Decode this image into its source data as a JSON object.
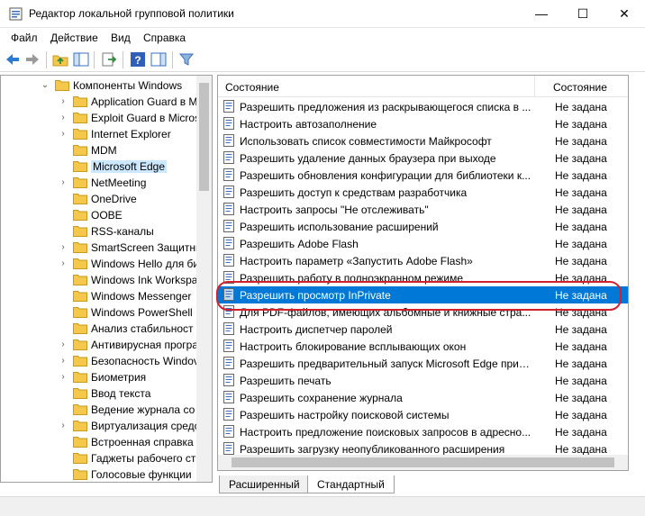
{
  "window": {
    "title": "Редактор локальной групповой политики",
    "minimize_glyph": "—",
    "maximize_glyph": "☐",
    "close_glyph": "✕"
  },
  "menu": [
    "Файл",
    "Действие",
    "Вид",
    "Справка"
  ],
  "toolbar_icons": [
    "back-icon",
    "forward-icon",
    "up-folder-icon",
    "show-hide-tree-icon",
    "export-list-icon",
    "help-icon",
    "show-hide-action-pane-icon",
    "filter-icon"
  ],
  "tree": {
    "items": [
      {
        "label": "Компоненты Windows",
        "expanded": true,
        "indent": 0
      },
      {
        "label": "Application Guard в M",
        "expanded": false,
        "indent": 1
      },
      {
        "label": "Exploit Guard в Micros",
        "expanded": false,
        "indent": 1
      },
      {
        "label": "Internet Explorer",
        "expanded": false,
        "indent": 1
      },
      {
        "label": "MDM",
        "expanded": null,
        "indent": 1
      },
      {
        "label": "Microsoft Edge",
        "expanded": null,
        "indent": 1,
        "selected": true
      },
      {
        "label": "NetMeeting",
        "expanded": false,
        "indent": 1
      },
      {
        "label": "OneDrive",
        "expanded": null,
        "indent": 1
      },
      {
        "label": "OOBE",
        "expanded": null,
        "indent": 1
      },
      {
        "label": "RSS-каналы",
        "expanded": null,
        "indent": 1
      },
      {
        "label": "SmartScreen Защитни",
        "expanded": false,
        "indent": 1
      },
      {
        "label": "Windows Hello для би",
        "expanded": false,
        "indent": 1
      },
      {
        "label": "Windows Ink Workspa",
        "expanded": null,
        "indent": 1
      },
      {
        "label": "Windows Messenger",
        "expanded": null,
        "indent": 1
      },
      {
        "label": "Windows PowerShell",
        "expanded": null,
        "indent": 1
      },
      {
        "label": "Анализ стабильност",
        "expanded": null,
        "indent": 1
      },
      {
        "label": "Антивирусная програ",
        "expanded": false,
        "indent": 1
      },
      {
        "label": "Безопасность Windov",
        "expanded": false,
        "indent": 1
      },
      {
        "label": "Биометрия",
        "expanded": false,
        "indent": 1
      },
      {
        "label": "Ввод текста",
        "expanded": null,
        "indent": 1
      },
      {
        "label": "Ведение журнала со",
        "expanded": null,
        "indent": 1
      },
      {
        "label": "Виртуализация средс",
        "expanded": false,
        "indent": 1
      },
      {
        "label": "Встроенная справка",
        "expanded": null,
        "indent": 1
      },
      {
        "label": "Гаджеты рабочего ст",
        "expanded": null,
        "indent": 1
      },
      {
        "label": "Голосовые функции",
        "expanded": null,
        "indent": 1
      }
    ]
  },
  "list": {
    "columns": [
      "Состояние",
      "Состояние"
    ],
    "rows": [
      {
        "name": "Разрешить предложения из раскрывающегося списка в ...",
        "state": "Не задана"
      },
      {
        "name": "Настроить автозаполнение",
        "state": "Не задана"
      },
      {
        "name": "Использовать список совместимости Майкрософт",
        "state": "Не задана"
      },
      {
        "name": "Разрешить удаление данных браузера при выходе",
        "state": "Не задана"
      },
      {
        "name": "Разрешить обновления конфигурации для библиотеки к...",
        "state": "Не задана"
      },
      {
        "name": "Разрешить доступ к средствам разработчика",
        "state": "Не задана"
      },
      {
        "name": "Настроить запросы \"Не отслеживать\"",
        "state": "Не задана"
      },
      {
        "name": "Разрешить использование расширений",
        "state": "Не задана"
      },
      {
        "name": "Разрешить Adobe Flash",
        "state": "Не задана"
      },
      {
        "name": "Настроить параметр «Запустить Adobe Flash»",
        "state": "Не задана"
      },
      {
        "name": "Разрешить работу в полноэкранном режиме",
        "state": "Не задана"
      },
      {
        "name": "Разрешить просмотр InPrivate",
        "state": "Не задана",
        "selected": true
      },
      {
        "name": "Для PDF-файлов, имеющих альбомные и книжные стра...",
        "state": "Не задана"
      },
      {
        "name": "Настроить диспетчер паролей",
        "state": "Не задана"
      },
      {
        "name": "Настроить блокирование всплывающих окон",
        "state": "Не задана"
      },
      {
        "name": "Разрешить предварительный запуск Microsoft Edge при з...",
        "state": "Не задана"
      },
      {
        "name": "Разрешить печать",
        "state": "Не задана"
      },
      {
        "name": "Разрешить сохранение журнала",
        "state": "Не задана"
      },
      {
        "name": "Разрешить настройку поисковой системы",
        "state": "Не задана"
      },
      {
        "name": "Настроить предложение поисковых запросов в адресно...",
        "state": "Не задана"
      },
      {
        "name": "Разрешить загрузку неопубликованного расширения",
        "state": "Не задана"
      }
    ]
  },
  "tabs": [
    {
      "label": "Расширенный",
      "active": false
    },
    {
      "label": "Стандартный",
      "active": true
    }
  ],
  "colors": {
    "selection": "#0078d7",
    "tree_selection": "#cce8ff",
    "highlight_ring": "#d2202f",
    "folder": "#f5c84b"
  }
}
